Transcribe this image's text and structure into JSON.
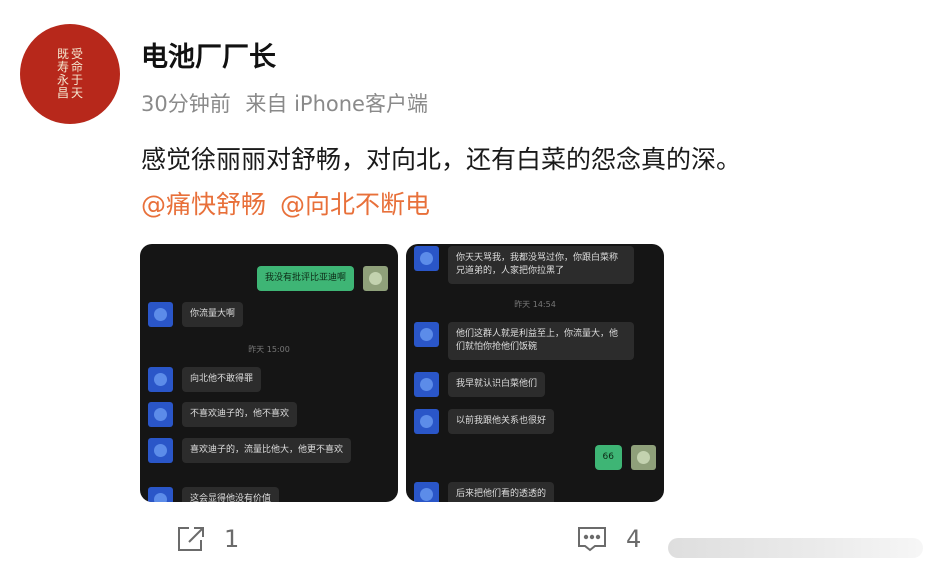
{
  "post": {
    "author": "电池厂厂长",
    "time": "30分钟前",
    "source": "来自 iPhone客户端",
    "text": "感觉徐丽丽对舒畅，对向北，还有白菜的怨念真的深。",
    "mentions": [
      "@痛快舒畅",
      "@向北不断电"
    ]
  },
  "avatar": {
    "columns": [
      "受命于天",
      "既寿永昌"
    ]
  },
  "screenshot_left": {
    "messages": [
      {
        "text": "我没有批评比亚迪啊",
        "side": "me"
      },
      {
        "text": "你流量大啊",
        "side": "other"
      },
      {
        "text": "向北他不敢得罪",
        "side": "other"
      },
      {
        "text": "不喜欢迪子的，他不喜欢",
        "side": "other"
      },
      {
        "text": "喜欢迪子的，流量比他大，他更不喜欢",
        "side": "other"
      },
      {
        "text": "这会显得他没有价值",
        "side": "other"
      }
    ],
    "time": "昨天 15:00"
  },
  "screenshot_right": {
    "messages": [
      {
        "text": "你天天骂我，我都没骂过你，你跟白菜称兄道弟的，人家把你拉黑了",
        "side": "other"
      },
      {
        "text": "他们这群人就是利益至上，你流量大，他们就怕你抢他们饭碗",
        "side": "other"
      },
      {
        "text": "我早就认识白菜他们",
        "side": "other"
      },
      {
        "text": "以前我跟他关系也很好",
        "side": "other"
      },
      {
        "text": "66",
        "side": "me"
      },
      {
        "text": "后来把他们看的透透的",
        "side": "other"
      }
    ],
    "time": "昨天 14:54"
  },
  "footer": {
    "share_count": "1",
    "comment_count": "4"
  },
  "colors": {
    "mention": "#e8703a",
    "meta": "#8a8a8a",
    "avatar_bg": "#b7281b",
    "chat_bg": "#151515",
    "bubble_me": "#3eb575"
  },
  "icons": {
    "share": "share-icon",
    "comment": "comment-icon"
  }
}
